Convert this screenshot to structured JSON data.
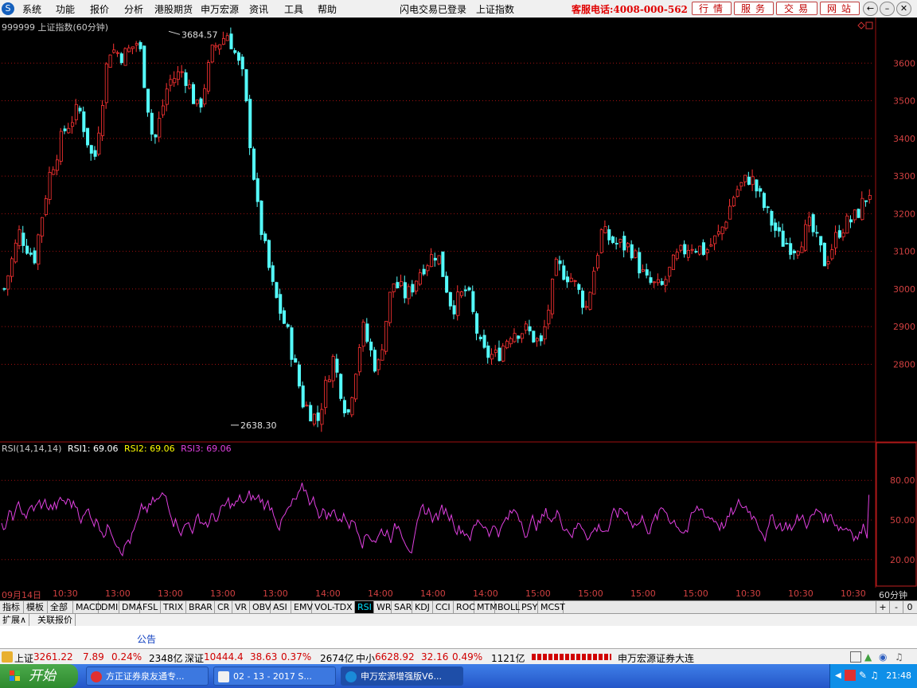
{
  "menu": {
    "items": [
      "系统",
      "功能",
      "报价",
      "分析",
      "港股期货",
      "申万宏源",
      "资讯",
      "工具",
      "帮助"
    ],
    "login_status": "闪电交易已登录",
    "index_name": "上证指数",
    "hotline": "客服电话:4008-000-562",
    "buttons": [
      "行情",
      "服务",
      "交易",
      "网站"
    ]
  },
  "chart": {
    "title": "999999 上证指数(60分钟)",
    "high_label": "3684.57",
    "low_label": "2638.30",
    "price_ticks": [
      "3600",
      "3500",
      "3400",
      "3300",
      "3200",
      "3100",
      "3000",
      "2900",
      "2800"
    ],
    "rsi_title": "RSI(14,14,14)",
    "rsi1": "RSI1: 69.06",
    "rsi2": "RSI2: 69.06",
    "rsi3": "RSI3: 69.06",
    "rsi_ticks": [
      "80.00",
      "50.00",
      "20.00"
    ],
    "period": "60分钟",
    "colors": {
      "up": "#ff3333",
      "down": "#54fcfc",
      "rsi": "#e040e0",
      "grid": "#a01010",
      "axis_text": "#d04040"
    }
  },
  "chart_data": {
    "type": "candlestick",
    "title": "999999 上证指数(60分钟)",
    "x_ticks": [
      "09月14日",
      "10:30",
      "13:00",
      "13:00",
      "13:00",
      "13:00",
      "14:00",
      "14:00",
      "14:00",
      "14:00",
      "15:00",
      "15:00",
      "15:00",
      "15:00",
      "10:30",
      "10:30",
      "10:30"
    ],
    "ylim": [
      2600,
      3700
    ],
    "annotated_high": 3684.57,
    "annotated_low": 2638.3,
    "close_path": [
      3000,
      3150,
      3080,
      3300,
      3420,
      3480,
      3330,
      3640,
      3620,
      3660,
      3380,
      3550,
      3580,
      3470,
      3640,
      3680,
      3560,
      3200,
      3000,
      2880,
      2700,
      2650,
      2820,
      2660,
      2900,
      2780,
      3020,
      2980,
      3060,
      3100,
      2950,
      3000,
      2830,
      2820,
      2890,
      2890,
      2850,
      3060,
      3030,
      2950,
      3150,
      3120,
      3110,
      3020,
      3000,
      3080,
      3120,
      3100,
      3150,
      3260,
      3300,
      3210,
      3130,
      3110,
      3170,
      3070,
      3160,
      3190,
      3260
    ],
    "rsi": {
      "series": [
        {
          "name": "RSI1",
          "last": 69.06
        },
        {
          "name": "RSI2",
          "last": 69.06
        },
        {
          "name": "RSI3",
          "last": 69.06
        }
      ],
      "ylim": [
        0,
        100
      ],
      "levels": [
        80,
        50,
        20
      ]
    }
  },
  "tabs": {
    "items": [
      "指标",
      "模板",
      "全部",
      "MACD",
      "DMI",
      "DMA",
      "FSL",
      "TRIX",
      "BRAR",
      "CR",
      "VR",
      "OBV",
      "ASI",
      "EMV",
      "VOL-TDX",
      "RSI",
      "WR",
      "SAR",
      "KDJ",
      "CCI",
      "ROC",
      "MTM",
      "BOLL",
      "PSY",
      "MCST"
    ],
    "active": "RSI",
    "controls": [
      "+",
      "-",
      "0"
    ]
  },
  "subtabs": [
    "扩展∧",
    "关联报价"
  ],
  "notice": "公告",
  "status": {
    "sh_label": "上证",
    "sh_value": "3261.22",
    "sh_change": "7.89",
    "sh_pct": "0.24%",
    "sh_amount": "2348亿",
    "sz_label": "深证",
    "sz_value": "10444.4",
    "sz_change": "38.63",
    "sz_pct": "0.37%",
    "sz_amount": "2674亿",
    "zx_label": "中小",
    "zx_value": "6628.92",
    "zx_change": "32.16",
    "zx_pct": "0.49%",
    "zx_amount": "1121亿",
    "broker": "申万宏源证券大连"
  },
  "taskbar": {
    "start": "开始",
    "tasks": [
      "方正证券泉友通专...",
      "02 - 13 - 2017 S...",
      "申万宏源增强版V6..."
    ],
    "clock": "21:48"
  }
}
